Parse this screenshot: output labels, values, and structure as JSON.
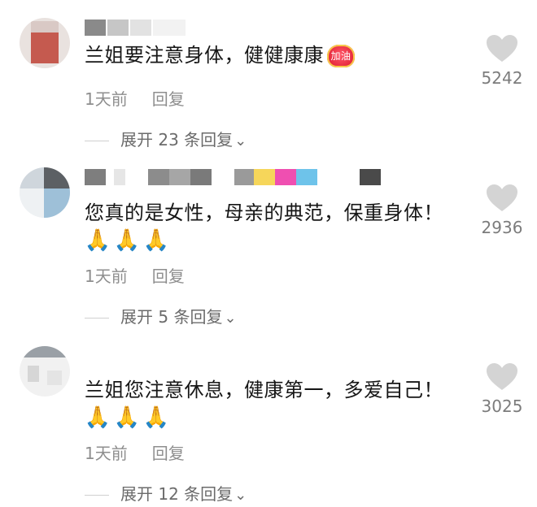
{
  "comments": [
    {
      "text": "兰姐要注意身体，健健康康",
      "badge": "加油",
      "emojis": [],
      "time": "1天前",
      "reply": "回复",
      "expand": "展开 23 条回复",
      "likes": "5242"
    },
    {
      "text": "您真的是女性，母亲的典范，保重身体！",
      "badge": "",
      "emojis": [
        "🙏",
        "🙏",
        "🙏"
      ],
      "time": "1天前",
      "reply": "回复",
      "expand": "展开 5 条回复",
      "likes": "2936"
    },
    {
      "text": "兰姐您注意休息，健康第一，多爱自己！",
      "badge": "",
      "emojis": [
        "🙏",
        "🙏",
        "🙏"
      ],
      "time": "1天前",
      "reply": "回复",
      "expand": "展开 12 条回复",
      "likes": "3025"
    }
  ],
  "icons": {
    "like": "heart-icon",
    "expand": "chevron-down-icon",
    "emoji": "pray-emoji-icon",
    "badge": "jiayou-badge-icon"
  },
  "colors": {
    "text": "#161616",
    "meta": "#8e8e8e",
    "heart": "#d4d4d4",
    "badge": "#e5283b"
  }
}
